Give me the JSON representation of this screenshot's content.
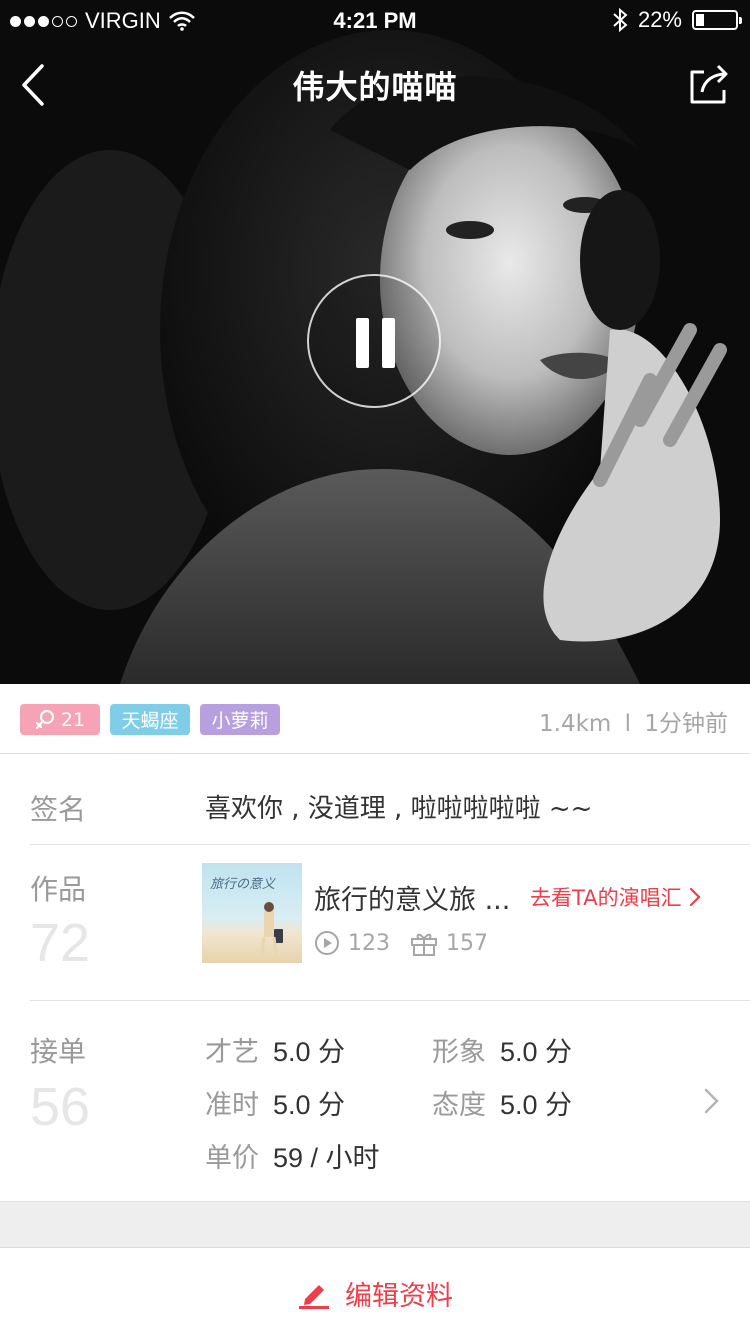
{
  "status_bar": {
    "carrier": "VIRGIN",
    "time": "4:21 PM",
    "battery": "22%"
  },
  "nav": {
    "title": "伟大的喵喵"
  },
  "tags": {
    "gender_age": "21",
    "zodiac": "天蝎座",
    "style": "小萝莉"
  },
  "meta": {
    "distance": "1.4km",
    "separator": "l",
    "last_seen": "1分钟前"
  },
  "signature": {
    "label": "签名",
    "text": "喜欢你 , 没道理 , 啦啦啦啦啦 ~~"
  },
  "works": {
    "label": "作品",
    "count": "72",
    "cover_text": "旅行の意义",
    "title": "旅行的意义旅 ...",
    "link": "去看TA的演唱汇",
    "plays": "123",
    "gifts": "157"
  },
  "orders": {
    "label": "接单",
    "count": "56",
    "ratings": [
      {
        "name": "才艺",
        "value": "5.0 分"
      },
      {
        "name": "形象",
        "value": "5.0 分"
      },
      {
        "name": "准时",
        "value": "5.0 分"
      },
      {
        "name": "态度",
        "value": "5.0 分"
      }
    ],
    "price_label": "单价",
    "price_value": "59 / 小时"
  },
  "edit": {
    "label": "编辑资料"
  },
  "colors": {
    "accent": "#ef3e4a",
    "tag_gender": "#f6a3b5",
    "tag_zodiac": "#7fcde6",
    "tag_style": "#b8a0e0"
  }
}
